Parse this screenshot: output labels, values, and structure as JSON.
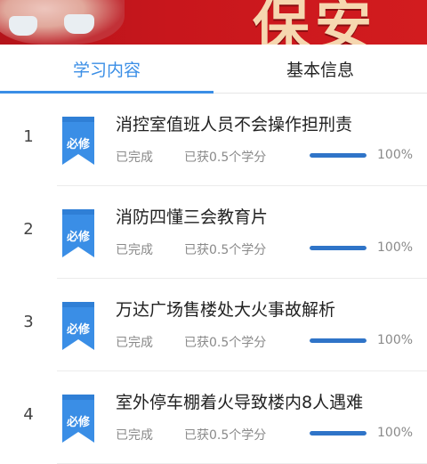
{
  "header": {
    "banner_title": "保安全"
  },
  "tabs": [
    {
      "label": "学习内容",
      "active": true
    },
    {
      "label": "基本信息",
      "active": false
    }
  ],
  "colors": {
    "accent": "#3a8ee6",
    "badge": "#3a8ee6",
    "progress": "#2f74c8",
    "banner": "#c8161c"
  },
  "courses": [
    {
      "index": "1",
      "badge": "必修",
      "title": "消控室值班人员不会操作担刑责",
      "status": "已完成",
      "credits": "已获0.5个学分",
      "progress": 1.0,
      "percent": "100%"
    },
    {
      "index": "2",
      "badge": "必修",
      "title": "消防四懂三会教育片",
      "status": "已完成",
      "credits": "已获0.5个学分",
      "progress": 1.0,
      "percent": "100%"
    },
    {
      "index": "3",
      "badge": "必修",
      "title": "万达广场售楼处大火事故解析",
      "status": "已完成",
      "credits": "已获0.5个学分",
      "progress": 1.0,
      "percent": "100%"
    },
    {
      "index": "4",
      "badge": "必修",
      "title": "室外停车棚着火导致楼内8人遇难",
      "status": "已完成",
      "credits": "已获0.5个学分",
      "progress": 1.0,
      "percent": "100%"
    }
  ]
}
